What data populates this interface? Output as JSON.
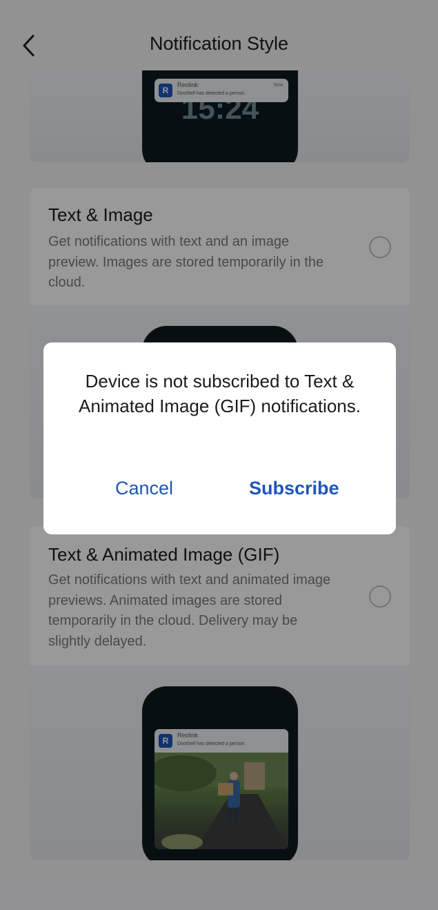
{
  "header": {
    "title": "Notification Style",
    "back_icon": "chevron-left-icon"
  },
  "top_preview": {
    "clock": "15:24",
    "notification": {
      "app": "Reolink",
      "message": "Doorbell has detected a person.",
      "time": "Now"
    }
  },
  "options": [
    {
      "title": "Text & Image",
      "description": "Get notifications with text and an image preview. Images are stored temporarily in the cloud.",
      "selected": false
    },
    {
      "title": "Text & Animated Image (GIF)",
      "description": "Get notifications with text and animated image previews. Animated images are stored temporarily in the cloud. Delivery may be slightly delayed.",
      "selected": false
    }
  ],
  "gif_preview": {
    "notification": {
      "app": "Reolink",
      "message": "Doorbell has detected a person."
    }
  },
  "dialog": {
    "message": "Device is not subscribed to Text & Animated Image (GIF) notifications.",
    "cancel_label": "Cancel",
    "subscribe_label": "Subscribe"
  },
  "colors": {
    "accent": "#1f56b8",
    "background": "#f4f4f6",
    "overlay": "rgba(0,0,0,0.40)"
  }
}
